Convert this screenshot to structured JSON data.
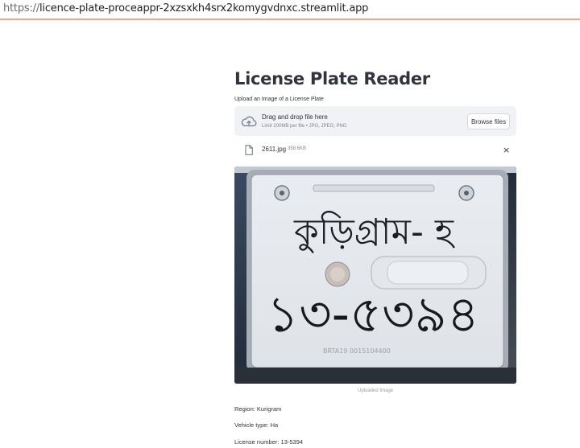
{
  "browser": {
    "url_scheme": "https://",
    "url_rest": "licence-plate-proceappr-2xzsxkh4srx2komygvdnxc.streamlit.app"
  },
  "page": {
    "title": "License Plate Reader",
    "upload_label": "Upload an Image of a License Plate"
  },
  "uploader": {
    "drop_text": "Drag and drop file here",
    "limit_text": "Limit 200MB per file • JPG, JPEG, PNG",
    "browse_label": "Browse files",
    "icon": "cloud-upload-icon"
  },
  "file": {
    "name": "2611.jpg",
    "size": "358.6KB",
    "close_symbol": "×"
  },
  "image": {
    "caption": "Uploaded Image",
    "plate_top_text": "কুড়িগ্রাম- হ",
    "plate_bottom_text": "১৩-৫৩৯৪",
    "plate_small_text": "BRTA19  0015104400"
  },
  "results": {
    "region": "Region: Kurigram",
    "vehicle_type": "Vehicle type: Ha",
    "license_number": "License number: 13-5394"
  }
}
